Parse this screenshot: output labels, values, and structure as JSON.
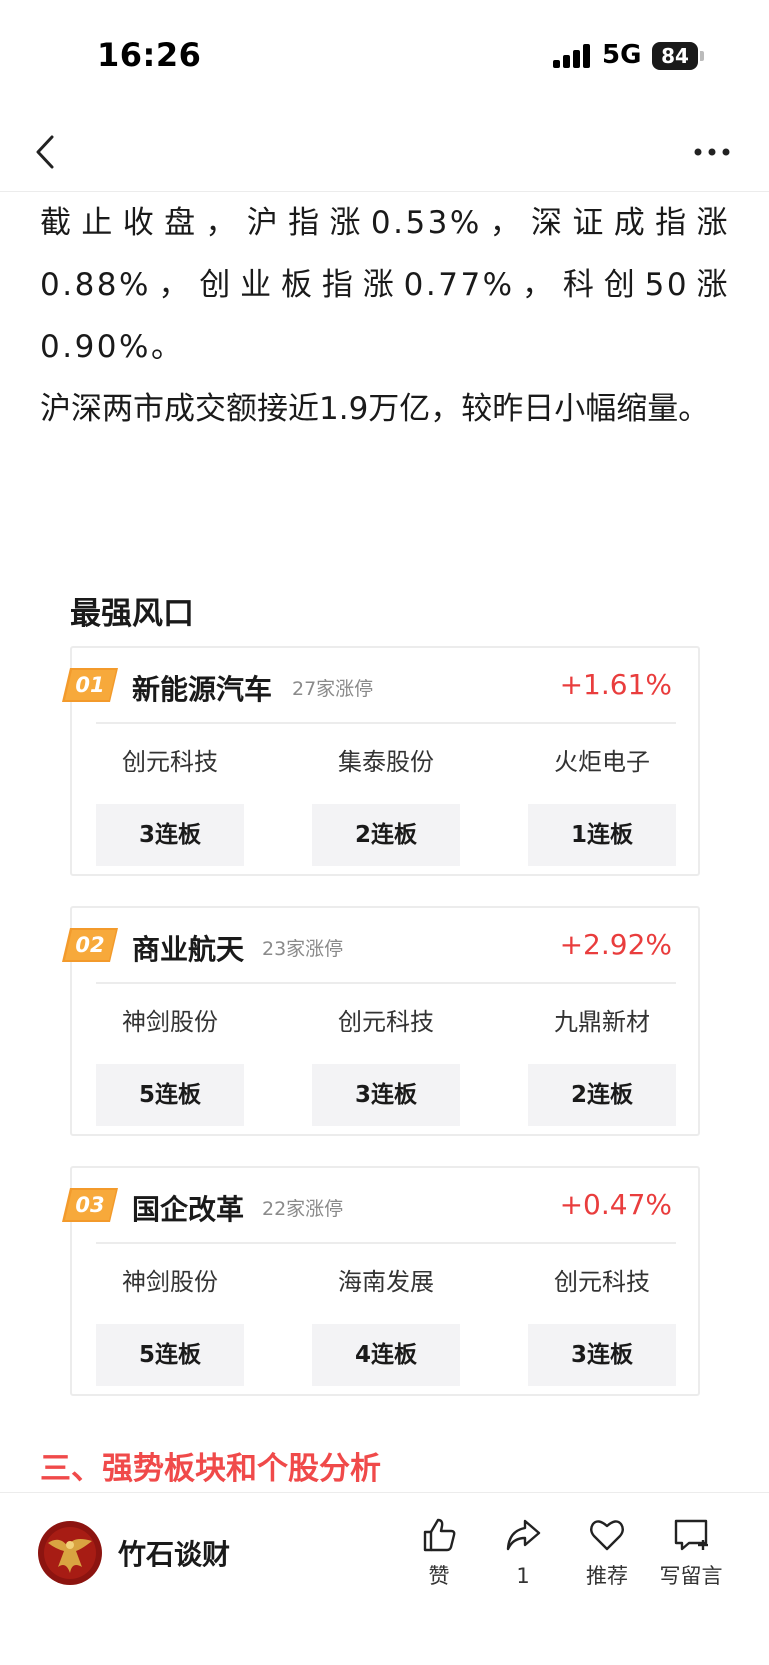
{
  "status": {
    "time": "16:26",
    "network": "5G",
    "battery": "84"
  },
  "article": {
    "paragraph1": "截止收盘，沪指涨0.53%，深证成指涨0.88%，创业板指涨0.77%，科创50涨0.90%。",
    "paragraph2": "沪深两市成交额接近1.9万亿，较昨日小幅缩量。"
  },
  "section_title": "最强风口",
  "sectors": [
    {
      "rank": "01",
      "name": "新能源汽车",
      "limit_up": "27家涨停",
      "change": "+1.61%",
      "stocks": [
        {
          "name": "创元科技",
          "board": "3连板"
        },
        {
          "name": "集泰股份",
          "board": "2连板"
        },
        {
          "name": "火炬电子",
          "board": "1连板"
        }
      ]
    },
    {
      "rank": "02",
      "name": "商业航天",
      "limit_up": "23家涨停",
      "change": "+2.92%",
      "stocks": [
        {
          "name": "神剑股份",
          "board": "5连板"
        },
        {
          "name": "创元科技",
          "board": "3连板"
        },
        {
          "name": "九鼎新材",
          "board": "2连板"
        }
      ]
    },
    {
      "rank": "03",
      "name": "国企改革",
      "limit_up": "22家涨停",
      "change": "+0.47%",
      "stocks": [
        {
          "name": "神剑股份",
          "board": "5连板"
        },
        {
          "name": "海南发展",
          "board": "4连板"
        },
        {
          "name": "创元科技",
          "board": "3连板"
        }
      ]
    }
  ],
  "subheading": "三、强势板块和个股分析",
  "bottom_bar": {
    "author": "竹石谈财",
    "like_label": "赞",
    "share_count": "1",
    "recommend_label": "推荐",
    "comment_label": "写留言"
  },
  "colors": {
    "accent_red": "#e93d3d",
    "heading_red": "#f04a4a",
    "badge_orange": "#f39a2b"
  },
  "icons": [
    "back-icon",
    "more-icon",
    "thumbs-up-icon",
    "share-icon",
    "heart-icon",
    "comment-icon"
  ]
}
